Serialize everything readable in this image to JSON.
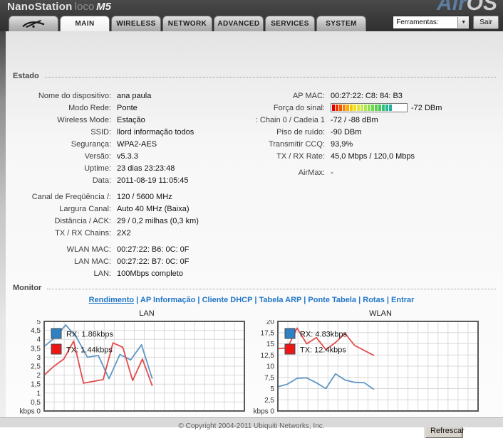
{
  "header": {
    "brand": {
      "name": "NanoStation",
      "sub": "loco",
      "model": "M5"
    },
    "airos": {
      "air": "Air",
      "os": "OS"
    },
    "tabs": [
      {
        "label": "MAIN",
        "active": true
      },
      {
        "label": "WIRELESS",
        "active": false
      },
      {
        "label": "NETWORK",
        "active": false
      },
      {
        "label": "ADVANCED",
        "active": false
      },
      {
        "label": "SERVICES",
        "active": false
      },
      {
        "label": "SYSTEM",
        "active": false
      }
    ],
    "logo_tab_icon": "ubiquiti-antenna",
    "tools_label": "Ferramentas:",
    "dropdown_arrow": "▼",
    "logout_label": "Sair"
  },
  "status": {
    "section_title": "Estado",
    "left_rows": [
      {
        "label": "Nome do dispositivo:",
        "value": "ana paula",
        "gap": false
      },
      {
        "label": "Modo Rede:",
        "value": "Ponte",
        "gap": false
      },
      {
        "label": "Wireless Mode:",
        "value": "Estação",
        "gap": false
      },
      {
        "label": "SSID:",
        "value": "llord informação todos",
        "gap": false
      },
      {
        "label": "Segurança:",
        "value": "WPA2-AES",
        "gap": false
      },
      {
        "label": "Versão:",
        "value": "v5.3.3",
        "gap": false
      },
      {
        "label": "Uptime:",
        "value": "23 dias 23:23:48",
        "gap": false
      },
      {
        "label": "Data:",
        "value": "2011-08-19 11:05:45",
        "gap": false
      },
      {
        "label": "Canal de Freqüência /:",
        "value": "120 / 5600 MHz",
        "gap": true
      },
      {
        "label": "Largura Canal:",
        "value": "Auto 40 MHz (Baixa)",
        "gap": false
      },
      {
        "label": "Distância / ACK:",
        "value": "29 / 0,2 milhas (0,3 km)",
        "gap": false
      },
      {
        "label": "TX / RX Chains:",
        "value": "2X2",
        "gap": false
      },
      {
        "label": "WLAN MAC:",
        "value": "00:27:22: B6: 0C: 0F",
        "gap": true
      },
      {
        "label": "LAN MAC:",
        "value": "00:27:22: B7: 0C: 0F",
        "gap": false
      },
      {
        "label": "LAN:",
        "value": "100Mbps completo",
        "gap": false
      }
    ],
    "right_rows": [
      {
        "label": "AP MAC:",
        "value": "00:27:22: C8: 84: B3",
        "type": "text",
        "gap": false
      },
      {
        "label": "Força do sinal:",
        "value": "-72 DBm",
        "type": "signal",
        "gap": false
      },
      {
        "label": ": Chain 0 / Cadeia 1",
        "value": "-72 / -88 dBm",
        "type": "text",
        "gap": false
      },
      {
        "label": "Piso de ruído:",
        "value": "-90 DBm",
        "type": "text",
        "gap": false
      },
      {
        "label": "Transmitir CCQ:",
        "value": "93,9%",
        "type": "text",
        "gap": false
      },
      {
        "label": "TX / RX Rate:",
        "value": "45,0 Mbps / 120,0 Mbps",
        "type": "text",
        "gap": false
      },
      {
        "label": "AirMax:",
        "value": "-",
        "type": "text",
        "gap": true
      }
    ],
    "signal_bar": {
      "colors": [
        "#dd0000",
        "#ee3300",
        "#f55900",
        "#f98200",
        "#fbaa00",
        "#f7c800",
        "#efdf1c",
        "#dfe73a",
        "#c7e94a",
        "#abe751",
        "#8fdf52",
        "#73d74e",
        "#58cf4b",
        "#43c75e",
        "#34bf7b",
        "#2ab793",
        "#25afa2"
      ],
      "empty_cells": 4
    }
  },
  "monitor": {
    "section_title": "Monitor",
    "links": [
      {
        "label": "Rendimento",
        "active": true
      },
      {
        "label": "AP Informação",
        "active": false
      },
      {
        "label": "Cliente DHCP",
        "active": false
      },
      {
        "label": "Tabela ARP",
        "active": false
      },
      {
        "label": "Ponte Tabela",
        "active": false
      },
      {
        "label": "Rotas",
        "active": false
      },
      {
        "label": "Entrar",
        "active": false
      }
    ],
    "separator": "|"
  },
  "chart_data": [
    {
      "type": "line",
      "title": "LAN",
      "ylabel": "kbps",
      "ylim": [
        0,
        5
      ],
      "ystep": 0.5,
      "bottom_tick_label": "kbps 0",
      "grid": true,
      "legend_position": "top-left",
      "x_fraction_end": 0.54,
      "series": [
        {
          "name": "RX",
          "legend": "RX: 1.86kbps",
          "swatch_color": "#2f81c4",
          "line_color": "#5e97c6",
          "values": [
            3.6,
            4.1,
            4.8,
            4.1,
            3.0,
            3.1,
            1.8,
            3.15,
            2.85,
            3.7,
            1.8
          ]
        },
        {
          "name": "TX",
          "legend": "TX: 1.44kbps",
          "swatch_color": "#ee1515",
          "line_color": "#e14b4b",
          "values": [
            2.0,
            2.5,
            2.9,
            3.9,
            1.55,
            1.65,
            1.75,
            3.8,
            3.55,
            1.7,
            2.9,
            1.4
          ]
        }
      ]
    },
    {
      "type": "line",
      "title": "WLAN",
      "ylabel": "kbps",
      "ylim": [
        0,
        20
      ],
      "ystep": 2.5,
      "bottom_tick_label": "kbps 0",
      "grid": true,
      "legend_position": "top-left",
      "x_fraction_end": 0.48,
      "series": [
        {
          "name": "RX",
          "legend": "RX: 4.83kbps",
          "swatch_color": "#2f81c4",
          "line_color": "#5e97c6",
          "values": [
            5.4,
            6.0,
            7.3,
            7.4,
            6.3,
            5.0,
            8.3,
            6.9,
            6.4,
            6.3,
            4.8
          ]
        },
        {
          "name": "TX",
          "legend": "TX: 12.4kbps",
          "swatch_color": "#ee1515",
          "line_color": "#e14b4b",
          "values": [
            13.9,
            14.1,
            18.5,
            15.0,
            16.4,
            13.7,
            15.3,
            17.3,
            14.6,
            13.5,
            12.4
          ]
        }
      ]
    }
  ],
  "refresh_label": "Refrescar",
  "footer": {
    "copyright": "© Copyright 2004-2011 Ubiquiti Networks, Inc."
  },
  "colors": {
    "link_blue": "#2277c8",
    "chart_border": "#5a5a5a",
    "grid_line": "#d9d9d9"
  }
}
